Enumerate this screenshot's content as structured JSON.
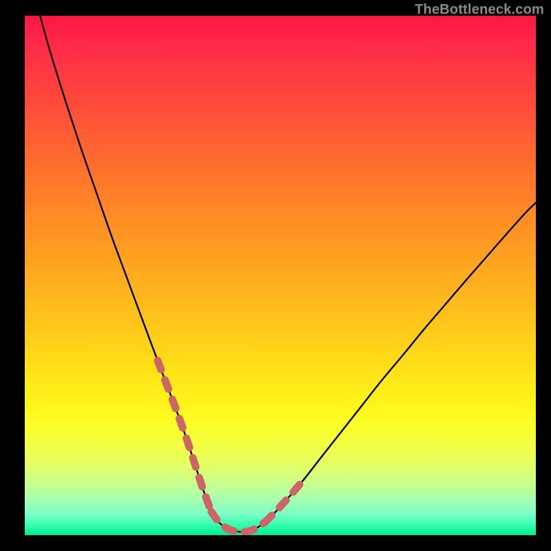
{
  "watermark": "TheBottleneck.com",
  "colors": {
    "page_bg": "#000000",
    "curve": "#000000",
    "highlight_stroke": "#cb6566",
    "gradient_top": "#ff1744",
    "gradient_bottom": "#00ea8d"
  },
  "chart_data": {
    "type": "line",
    "title": "",
    "xlabel": "",
    "ylabel": "",
    "xlim": [
      0,
      100
    ],
    "ylim": [
      0,
      100
    ],
    "grid": false,
    "legend": false,
    "series": [
      {
        "name": "bottleneck-curve",
        "x": [
          3,
          5,
          8,
          11,
          14,
          17,
          20,
          23,
          26,
          29,
          31.5,
          33.5,
          35,
          36.5,
          38.5,
          41,
          44,
          47,
          50,
          54,
          58,
          62,
          66,
          70,
          74,
          78,
          82,
          86,
          90,
          94,
          98,
          100
        ],
        "values": [
          100,
          93,
          83.5,
          74.5,
          66,
          57.5,
          49.5,
          41.5,
          33.6,
          25.8,
          19,
          13,
          8.5,
          4.5,
          2,
          0.8,
          0.8,
          2.5,
          5.5,
          10,
          15,
          20,
          25,
          30,
          34.7,
          39.5,
          44.1,
          48.7,
          53.2,
          57.7,
          62.1,
          64
        ]
      }
    ],
    "highlight_segments": [
      {
        "x": [
          26,
          29,
          31.5,
          33.5,
          35,
          36.5
        ],
        "values": [
          33.6,
          25.8,
          19,
          13,
          8.5,
          4.5
        ]
      },
      {
        "x": [
          36.5,
          38.5,
          41,
          44,
          47
        ],
        "values": [
          4.5,
          2,
          0.8,
          0.8,
          2.5
        ]
      },
      {
        "x": [
          47,
          50,
          54
        ],
        "values": [
          2.5,
          5.5,
          10
        ]
      }
    ]
  }
}
